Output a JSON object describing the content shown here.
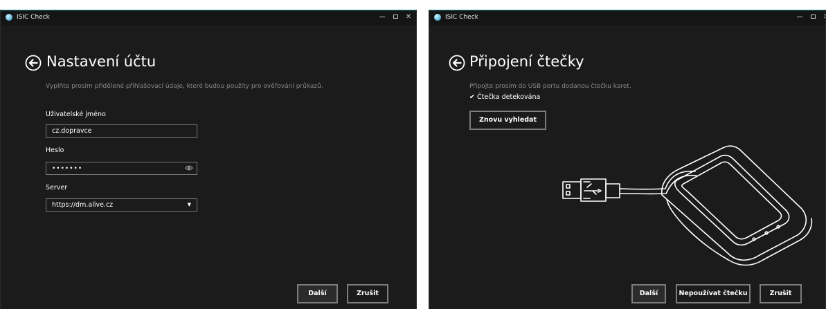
{
  "account_window": {
    "title": "ISIC Check",
    "heading": "Nastavení účtu",
    "description": "Vyplňte prosím přidělené přihlašovací údaje, které budou použity pro ověřování průkazů.",
    "username_label": "Uživatelské jméno",
    "username_value": "cz.dopravce",
    "password_label": "Heslo",
    "password_value": "•••••••",
    "server_label": "Server",
    "server_value": "https://dm.alive.cz",
    "next_label": "Další",
    "cancel_label": "Zrušit",
    "close_glyph": "✕"
  },
  "reader_window": {
    "title": "ISIC Check",
    "heading": "Připojení čtečky",
    "description": "Připojte prosím do USB portu dodanou čtečku karet.",
    "check_glyph": "✔",
    "detected_text": "Čtečka detekována",
    "rescan_label": "Znovu vyhledat",
    "next_label": "Další",
    "no_reader_label": "Nepoužívat čtečku",
    "cancel_label": "Zrušit",
    "close_glyph": "✕"
  },
  "icons": {
    "app": "isic-app-icon",
    "back": "back-arrow-circle-icon",
    "reveal": "eye-icon",
    "dropdown": "chevron-down-icon",
    "illustration": "usb-card-reader-illustration"
  },
  "colors": {
    "window_background": "#1b1b1b",
    "titlebar_background": "#151515",
    "accent_border": "#2aa6b8",
    "muted_text": "#8a8a8a",
    "field_border": "#7a7a7a"
  }
}
